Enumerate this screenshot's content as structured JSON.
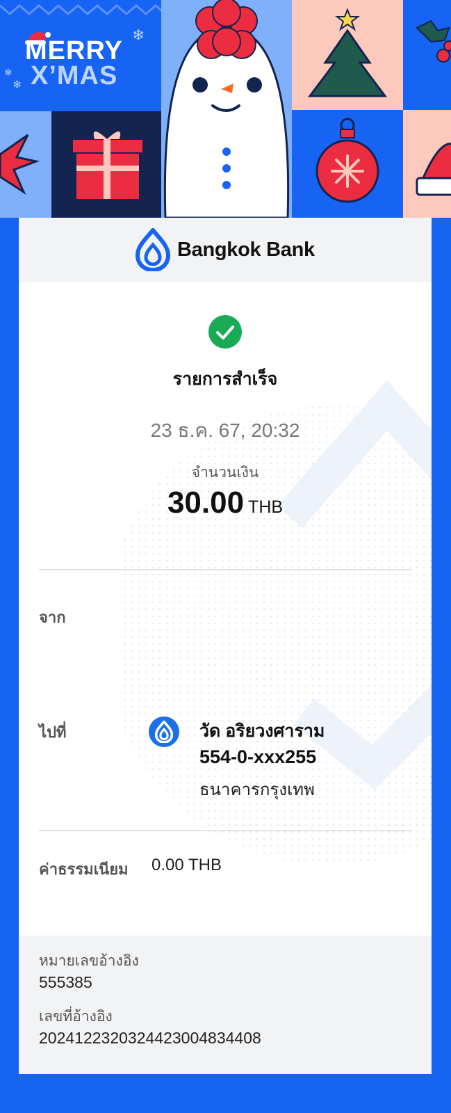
{
  "banner": {
    "line1": "MERRY",
    "line2": "X’MAS",
    "colors": {
      "blue": "#1763f3",
      "navy": "#12244f",
      "pink": "#fdc9bd",
      "light_blue": "#7fb0f9",
      "red": "#ec2c40"
    }
  },
  "header": {
    "bank_name": "Bangkok Bank",
    "logo_icon": "bangkok-bank-lotus-icon"
  },
  "status": {
    "icon": "check-circle-icon",
    "text": "รายการสำเร็จ",
    "color": "#1aaa55"
  },
  "datetime": "23 ธ.ค. 67, 20:32",
  "amount": {
    "label": "จำนวนเงิน",
    "value": "30.00",
    "currency": "THB"
  },
  "from": {
    "label": "จาก"
  },
  "to": {
    "label": "ไปที่",
    "icon": "bangkok-bank-lotus-icon",
    "name": "วัด อริยวงศาราม",
    "account": "554-0-xxx255",
    "bank": "ธนาคารกรุงเทพ"
  },
  "fee": {
    "label": "ค่าธรรมเนียม",
    "value": "0.00 THB"
  },
  "reference": {
    "ref1_label": "หมายเลขอ้างอิง",
    "ref1_value": "555385",
    "ref2_label": "เลขที่อ้างอิง",
    "ref2_value": "2024122320324423004834408"
  }
}
